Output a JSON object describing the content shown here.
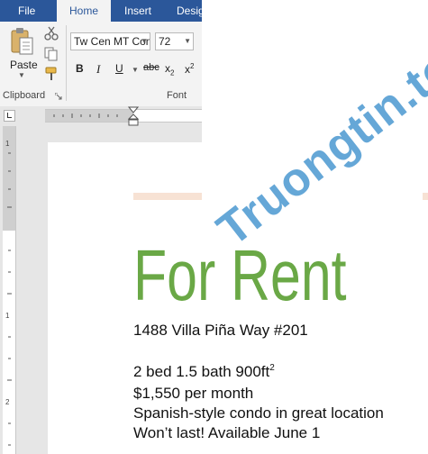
{
  "ribbon": {
    "tabs": {
      "file": "File",
      "home": "Home",
      "insert": "Insert",
      "design": "Design"
    },
    "clipboard": {
      "paste_label": "Paste",
      "group_label": "Clipboard"
    },
    "font": {
      "name": "Tw Cen MT Condensed",
      "size": "72",
      "group_label": "Font",
      "bold": "B",
      "italic": "I",
      "underline": "U",
      "strikethrough": "abc",
      "subscript": "x",
      "subscript_mark": "2",
      "superscript": "x",
      "superscript_mark": "2"
    }
  },
  "vertical_ruler": {
    "marks": [
      "1",
      "1",
      "2"
    ]
  },
  "document": {
    "headline": "For Rent",
    "address": "1488 Villa Piña Way #201",
    "details": "2 bed 1.5 bath 900ft",
    "details_sup": "2",
    "price": "$1,550 per month",
    "description": "Spanish-style condo in great location",
    "availability": "Won’t last! Available June 1",
    "headline_color": "#6aa846"
  },
  "watermark": "Truongtin.top",
  "colors": {
    "ribbon_blue": "#2b579a",
    "accent": "#f7e2d4"
  }
}
